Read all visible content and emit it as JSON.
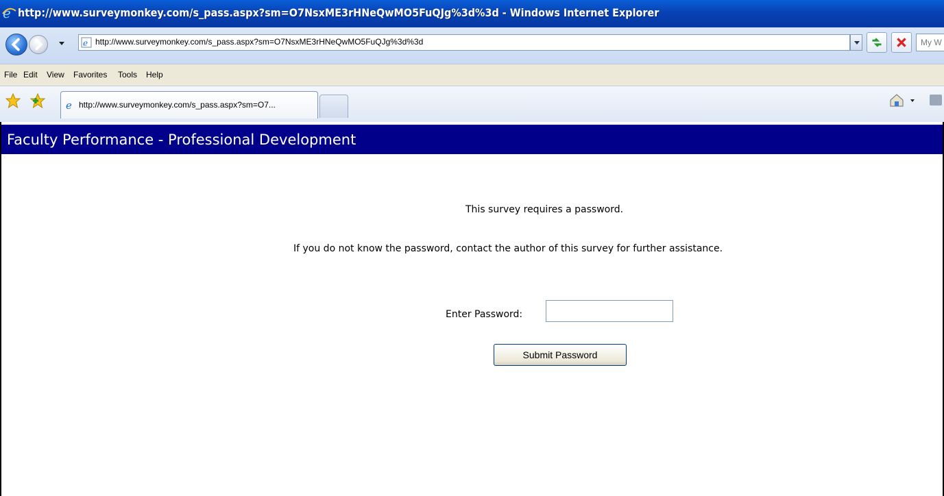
{
  "window": {
    "title": "http://www.surveymonkey.com/s_pass.aspx?sm=O7NsxME3rHNeQwMO5FuQJg%3d%3d - Windows Internet Explorer"
  },
  "address_bar": {
    "url": "http://www.surveymonkey.com/s_pass.aspx?sm=O7NsxME3rHNeQwMO5FuQJg%3d%3d",
    "search_placeholder": "My W"
  },
  "menu": {
    "items": [
      "File",
      "Edit",
      "View",
      "Favorites",
      "Tools",
      "Help"
    ]
  },
  "tabs": {
    "active_label": "http://www.surveymonkey.com/s_pass.aspx?sm=O7..."
  },
  "page": {
    "header_title": "Faculty Performance - Professional Development",
    "message_1": "This survey requires a password.",
    "message_2": "If you do not know the password, contact the author of this survey for further assistance.",
    "password_label": "Enter Password:",
    "password_value": "",
    "submit_label": "Submit Password"
  },
  "colors": {
    "titlebar": "#0842b4",
    "page_header": "#00008b",
    "menubar": "#ece9d8"
  },
  "icons": [
    "ie-logo-icon",
    "back-arrow-icon",
    "forward-arrow-icon",
    "page-icon",
    "refresh-icon",
    "stop-icon",
    "favorites-star-icon",
    "add-favorite-icon",
    "home-icon",
    "feeds-icon"
  ]
}
